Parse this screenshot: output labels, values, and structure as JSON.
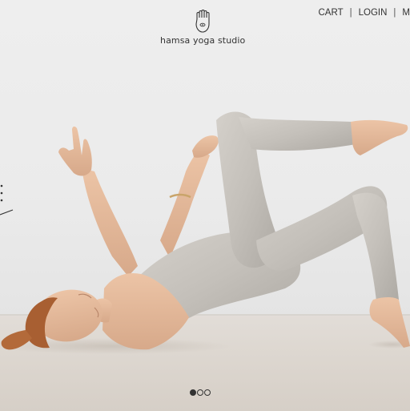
{
  "brand": {
    "name": "hamsa yoga studio",
    "logo": "hamsa-hand-icon"
  },
  "nav": {
    "items": [
      {
        "label": "CART"
      },
      {
        "label": "LOGIN"
      },
      {
        "label": "M"
      }
    ]
  },
  "carousel": {
    "slides": 3,
    "active_index": 0
  },
  "colors": {
    "wall": "#ececec",
    "floor": "#dcd6cf",
    "text": "#333333",
    "outfit": "#c7c3bd",
    "skin": "#e3b89a",
    "hair": "#a85f32"
  }
}
